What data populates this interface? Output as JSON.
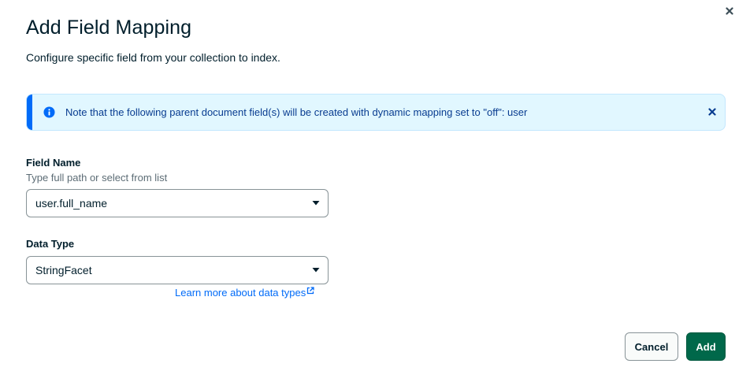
{
  "modal": {
    "title": "Add Field Mapping",
    "subtitle": "Configure specific field from your collection to index."
  },
  "banner": {
    "icon": "info-icon",
    "text": "Note that the following parent document field(s) will be created with dynamic mapping set to \"off\": user",
    "accent_color": "#016bf8",
    "background_color": "#e1f7ff"
  },
  "field_name": {
    "label": "Field Name",
    "description": "Type full path or select from list",
    "value": "user.full_name"
  },
  "data_type": {
    "label": "Data Type",
    "value": "StringFacet",
    "learn_more_link": "Learn more about data types"
  },
  "footer": {
    "cancel_label": "Cancel",
    "add_label": "Add",
    "primary_color": "#00684a"
  }
}
